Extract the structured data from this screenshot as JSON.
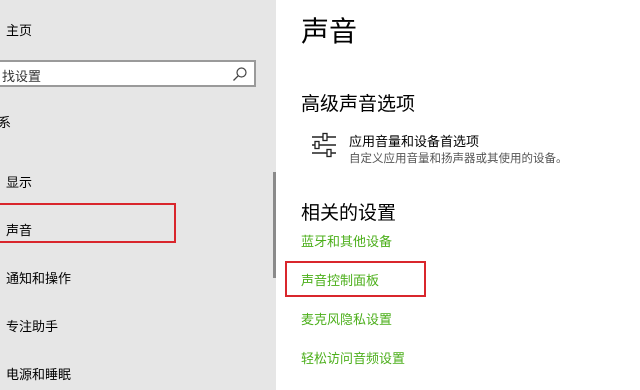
{
  "sidebar": {
    "home_label": "主页",
    "search_placeholder": "找设置",
    "group_label_fragment": "系",
    "items": [
      {
        "label": "显示"
      },
      {
        "label": "声音"
      },
      {
        "label": "通知和操作"
      },
      {
        "label": "专注助手"
      },
      {
        "label": "电源和睡眠"
      }
    ],
    "selected_index": 1
  },
  "main": {
    "title": "声音",
    "advanced": {
      "heading": "高级声音选项",
      "icon": "sliders-icon",
      "label": "应用音量和设备首选项",
      "description": "自定义应用音量和扬声器或其使用的设备。"
    },
    "related": {
      "heading": "相关的设置",
      "links": [
        {
          "label": "蓝牙和其他设备"
        },
        {
          "label": "声音控制面板"
        },
        {
          "label": "麦克风隐私设置"
        },
        {
          "label": "轻松访问音频设置"
        }
      ]
    }
  },
  "colors": {
    "accent_link": "#4caf1b",
    "highlight_box": "#d9262c",
    "sidebar_bg": "#e6e6e6"
  }
}
